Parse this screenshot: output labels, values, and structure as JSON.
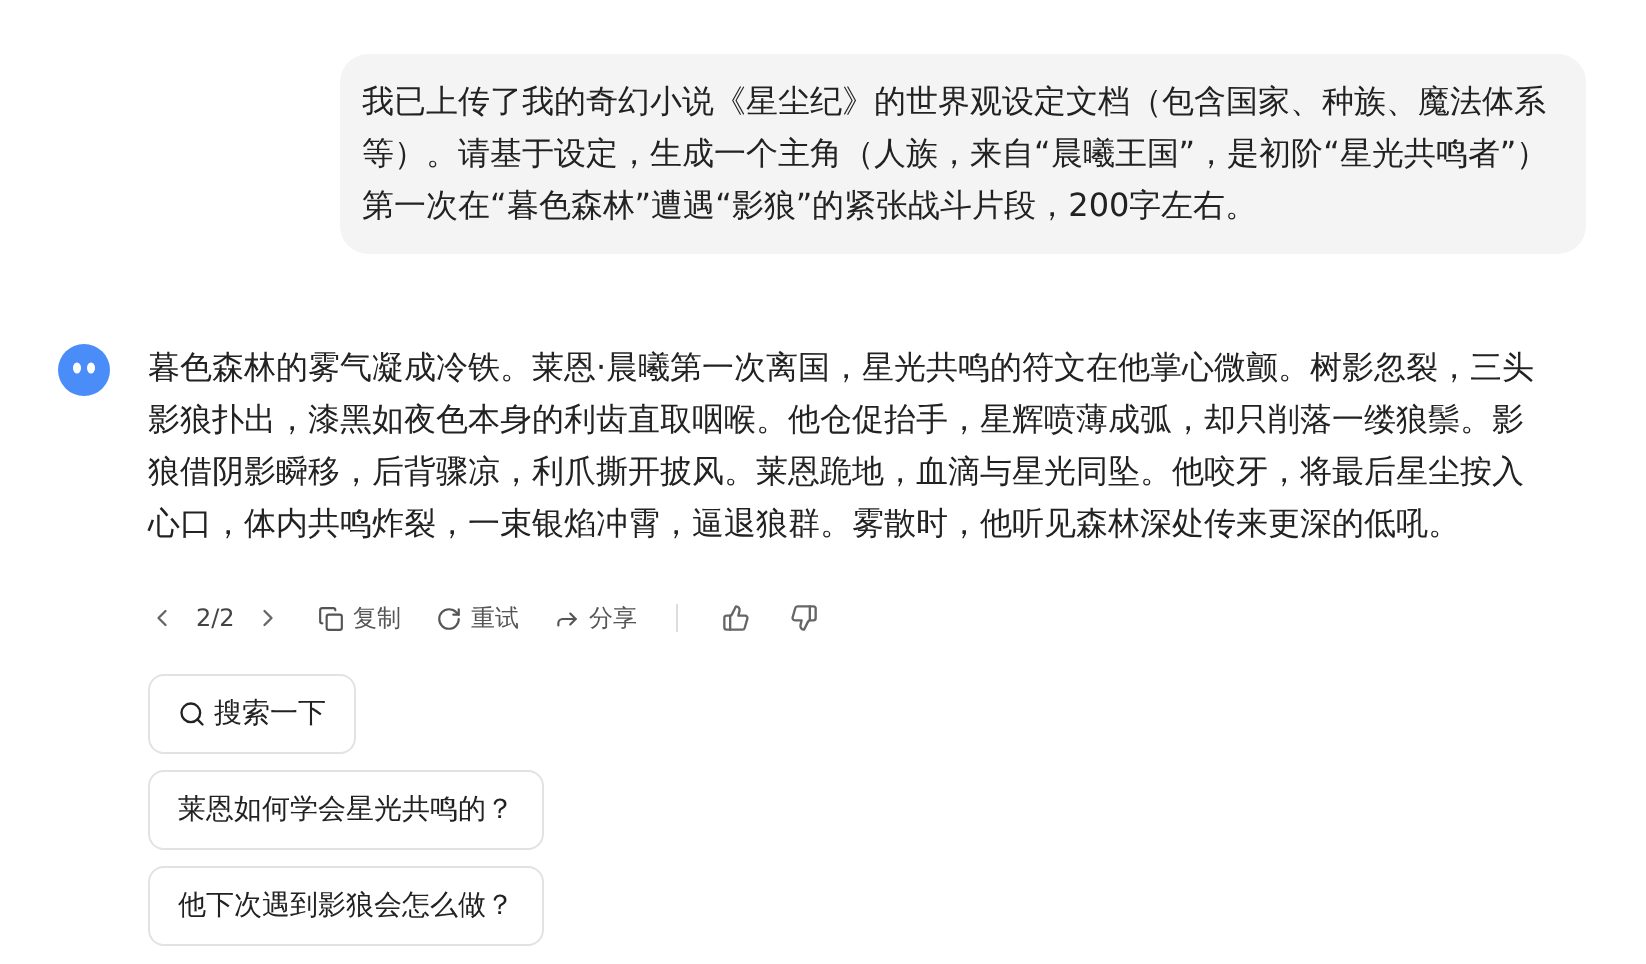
{
  "user_message": {
    "text": "我已上传了我的奇幻小说《星尘纪》的世界观设定文档（包含国家、种族、魔法体系等）。请基于设定，生成一个主角（人族，来自“晨曦王国”，是初阶“星光共鸣者”）第一次在“暮色森林”遭遇“影狼”的紧张战斗片段，200字左右。"
  },
  "reply": {
    "text": "暮色森林的雾气凝成冷铁。莱恩·晨曦第一次离国，星光共鸣的符文在他掌心微颤。树影忽裂，三头影狼扑出，漆黑如夜色本身的利齿直取咽喉。他仓促抬手，星辉喷薄成弧，却只削落一缕狼鬃。影狼借阴影瞬移，后背骤凉，利爪撕开披风。莱恩跪地，血滴与星光同坠。他咬牙，将最后星尘按入心口，体内共鸣炸裂，一束银焰冲霄，逼退狼群。雾散时，他听见森林深处传来更深的低吼。",
    "pager": "2/2",
    "actions": [
      {
        "kind": "copy",
        "label": "复制"
      },
      {
        "kind": "retry",
        "label": "重试"
      },
      {
        "kind": "share",
        "label": "分享"
      }
    ]
  },
  "search_button": {
    "label": "搜索一下"
  },
  "suggestions": [
    "莱恩如何学会星光共鸣的？",
    "他下次遇到影狼会怎么做？"
  ]
}
